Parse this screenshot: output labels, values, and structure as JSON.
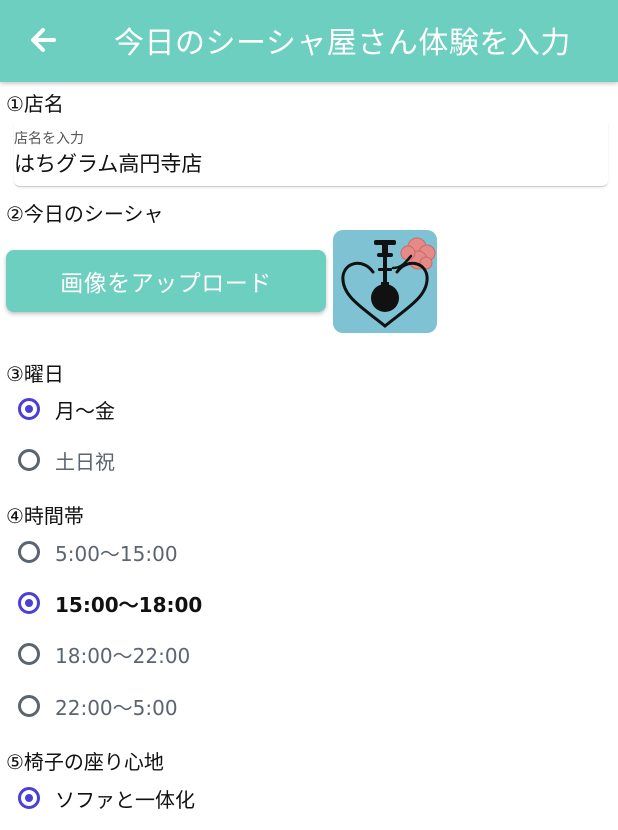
{
  "header": {
    "title": "今日のシーシャ屋さん体験を入力",
    "back_icon": "arrow-left-icon",
    "color": "#6dcfbf"
  },
  "store": {
    "section_title": "①店名",
    "field_label": "店名を入力",
    "field_value": "はちグラム高円寺店"
  },
  "shisha": {
    "section_title": "②今日のシーシャ",
    "upload_label": "画像をアップロード",
    "thumbnail_icon": "hookah-heart-icon"
  },
  "day": {
    "section_title": "③曜日",
    "options": [
      {
        "label": "月～金",
        "checked": true
      },
      {
        "label": "土日祝",
        "checked": false
      }
    ]
  },
  "time": {
    "section_title": "④時間帯",
    "options": [
      {
        "label": "5:00～15:00",
        "checked": false
      },
      {
        "label": "15:00～18:00",
        "checked": true
      },
      {
        "label": "18:00～22:00",
        "checked": false
      },
      {
        "label": "22:00～5:00",
        "checked": false
      }
    ]
  },
  "chair": {
    "section_title": "⑤椅子の座り心地",
    "options": [
      {
        "label": "ソファと一体化",
        "checked": true
      }
    ]
  },
  "colors": {
    "accent": "#6dcfbf",
    "radio_selected": "#4a3fd8",
    "radio_unselected": "#5c6470"
  }
}
